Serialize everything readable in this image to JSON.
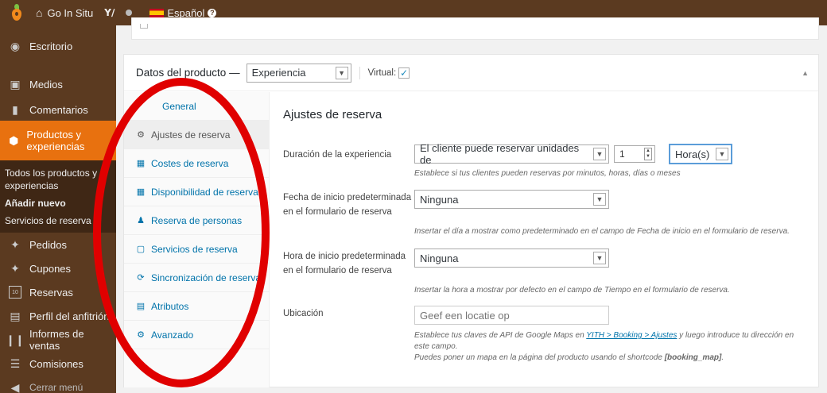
{
  "adminbar": {
    "site_name": "Go In Situ",
    "language": "Español"
  },
  "sidebar": {
    "items": [
      {
        "label": "Escritorio"
      },
      {
        "label": "Medios"
      },
      {
        "label": "Comentarios"
      },
      {
        "label": "Productos y experiencias"
      },
      {
        "label": "Pedidos"
      },
      {
        "label": "Cupones"
      },
      {
        "label": "Reservas"
      },
      {
        "label": "Perfil del anfitrión"
      },
      {
        "label": "Informes de ventas"
      },
      {
        "label": "Comisiones"
      },
      {
        "label": "Cerrar menú"
      }
    ],
    "submenu": [
      {
        "label": "Todos los productos y experiencias"
      },
      {
        "label": "Añadir nuevo"
      },
      {
        "label": "Servicios de reserva"
      }
    ],
    "reservas_icon_text": "10"
  },
  "panel": {
    "title": "Datos del producto —",
    "product_type": "Experiencia",
    "virtual_label": "Virtual:",
    "virtual_mark": "✓"
  },
  "tabs": [
    {
      "label": "General"
    },
    {
      "label": "Ajustes de reserva"
    },
    {
      "label": "Costes de reserva"
    },
    {
      "label": "Disponibilidad de reserva"
    },
    {
      "label": "Reserva de personas"
    },
    {
      "label": "Servicios de reserva"
    },
    {
      "label": "Sincronización de reserva"
    },
    {
      "label": "Atributos"
    },
    {
      "label": "Avanzado"
    }
  ],
  "content": {
    "section_title": "Ajustes de reserva",
    "duration": {
      "label": "Duración de la experiencia",
      "mode": "El cliente puede reservar unidades de",
      "quantity": "1",
      "unit": "Hora(s)",
      "desc": "Establece si tus clientes pueden reservas por minutos, horas, días o meses"
    },
    "start_date": {
      "label_line1": "Fecha de inicio predeterminada",
      "label_line2": "en el formulario de reserva",
      "value": "Ninguna",
      "desc": "Insertar el día a mostrar como predeterminado en el campo de Fecha de inicio en el formulario de reserva."
    },
    "start_time": {
      "label_line1": "Hora de inicio predeterminada",
      "label_line2": "en el formulario de reserva",
      "value": "Ninguna",
      "desc": "Insertar la hora a mostrar por defecto en el campo de Tiempo en el formulario de reserva."
    },
    "location": {
      "label": "Ubicación",
      "placeholder": "Geef een locatie op",
      "desc_prefix": "Establece tus claves de API de Google Maps en ",
      "desc_link": "YITH > Booking > Ajustes",
      "desc_suffix": " y luego introduce tu dirección en",
      "desc_line2": "este campo.",
      "desc_line3_prefix": "Puedes poner un mapa en la página del producto usando el shortcode ",
      "desc_line3_code": "[booking_map]",
      "desc_line3_suffix": "."
    }
  },
  "colors": {
    "sidebar_bg": "#5b3a20",
    "accent": "#e8710f",
    "annotation": "#e00000",
    "link": "#0073aa"
  }
}
